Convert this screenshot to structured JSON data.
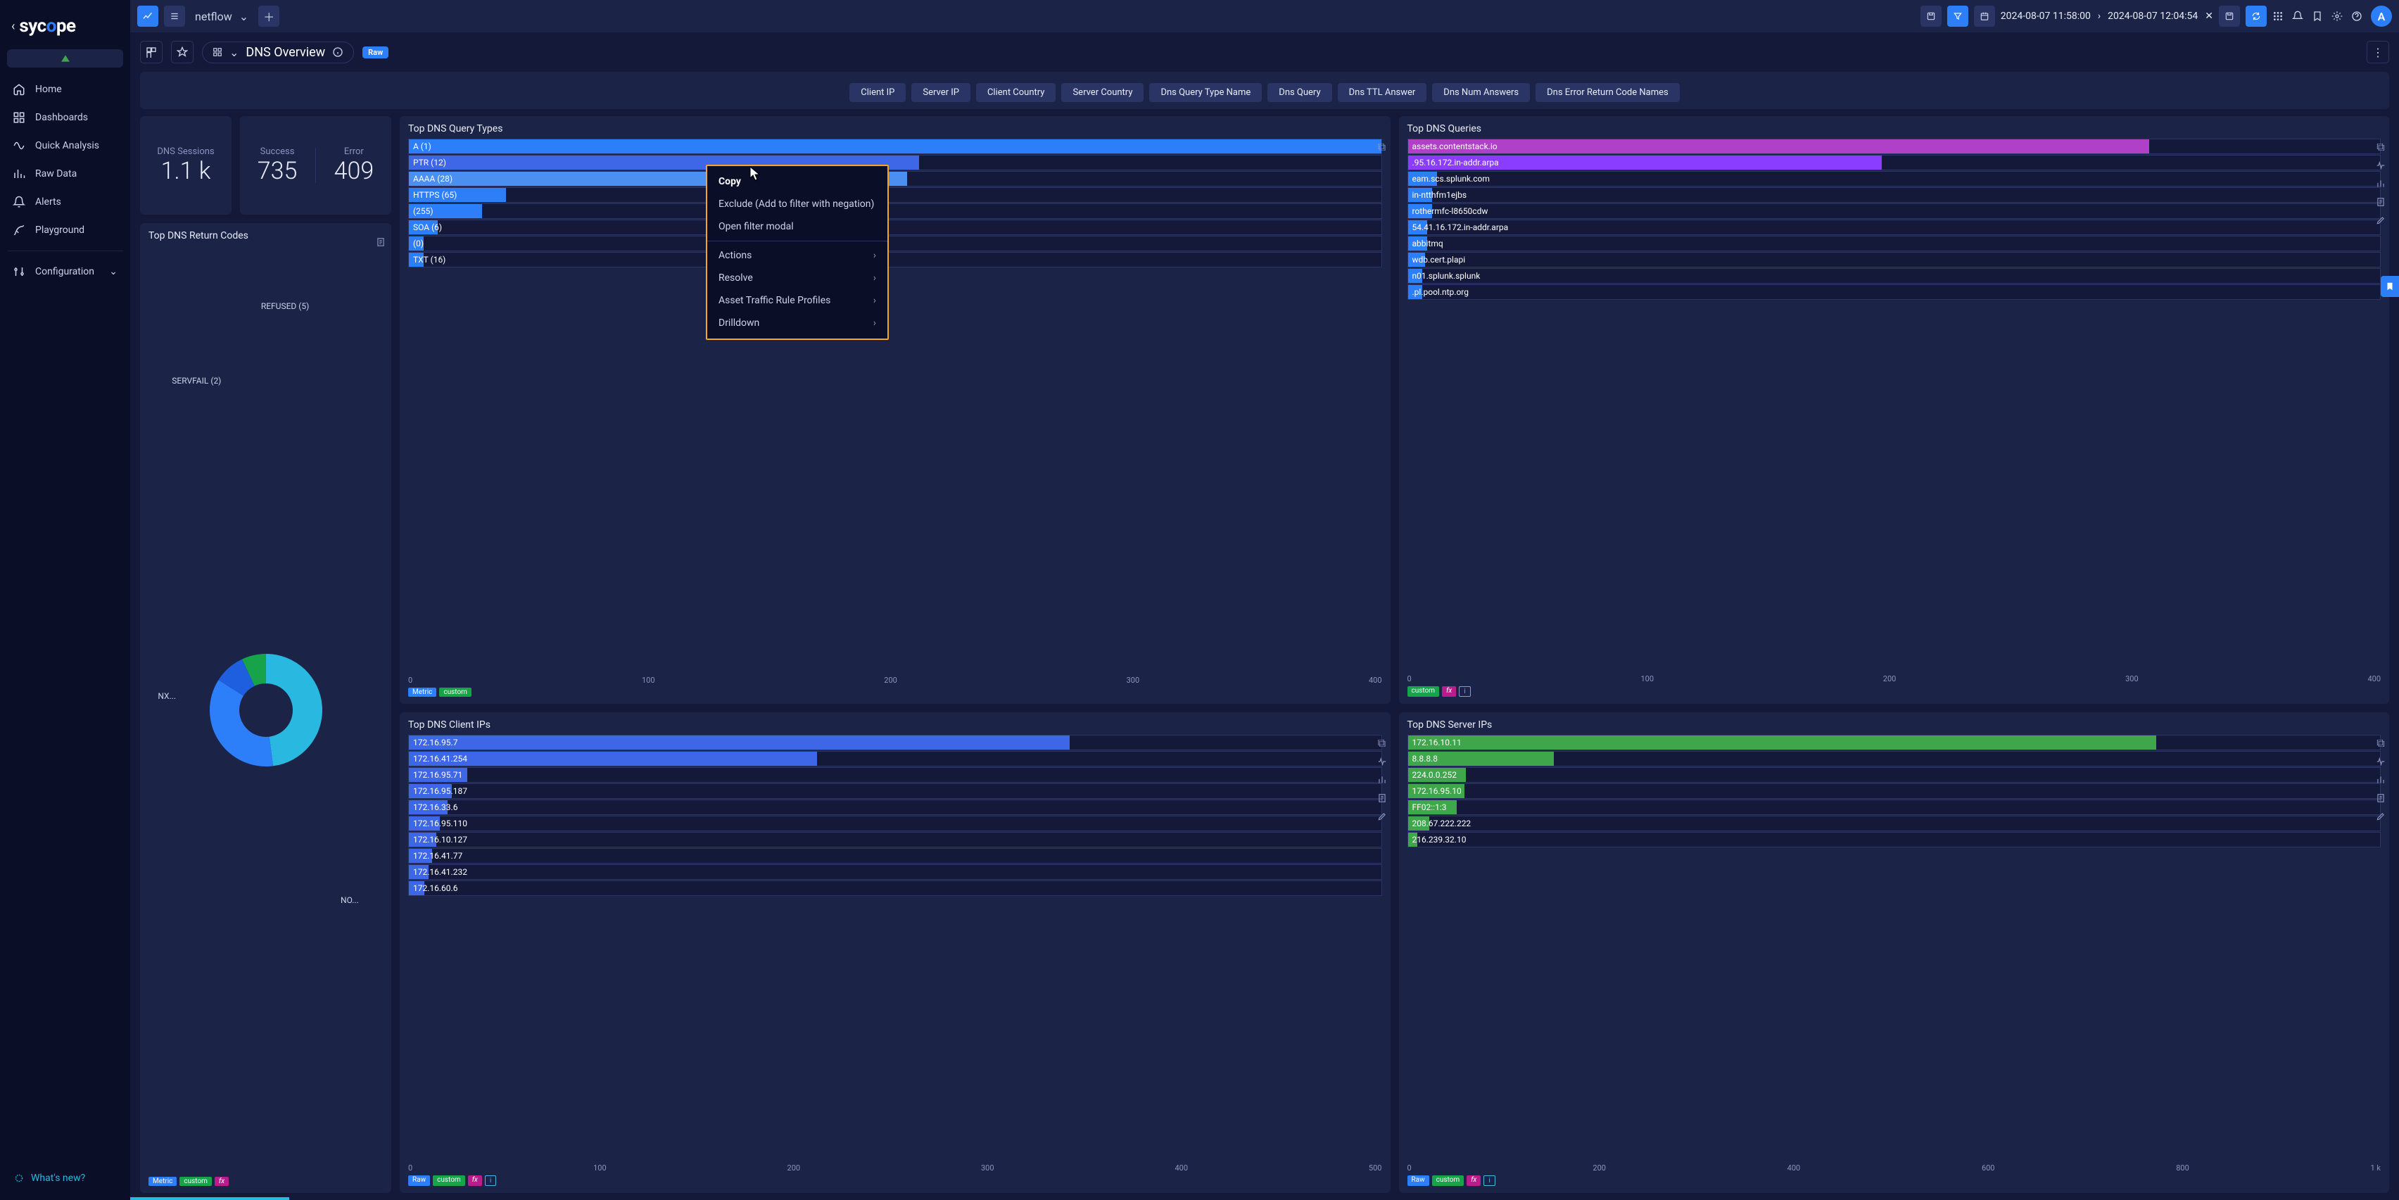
{
  "logo": {
    "text_pre": "syc",
    "text_mid": "o",
    "text_post": "pe"
  },
  "sidebar": {
    "items": [
      {
        "id": "home",
        "label": "Home"
      },
      {
        "id": "dashboards",
        "label": "Dashboards"
      },
      {
        "id": "quick-analysis",
        "label": "Quick Analysis"
      },
      {
        "id": "raw-data",
        "label": "Raw Data"
      },
      {
        "id": "alerts",
        "label": "Alerts"
      },
      {
        "id": "playground",
        "label": "Playground"
      }
    ],
    "config": {
      "label": "Configuration"
    },
    "whatsnew": "What's new?"
  },
  "topbar": {
    "stream": "netflow",
    "date_from": "2024-08-07 11:58:00",
    "date_to": "2024-08-07 12:04:54",
    "avatar_initial": "A"
  },
  "subhead": {
    "title": "DNS Overview",
    "raw_badge": "Raw"
  },
  "filters": [
    "Client IP",
    "Server IP",
    "Client Country",
    "Server Country",
    "Dns Query Type Name",
    "Dns Query",
    "Dns TTL Answer",
    "Dns Num Answers",
    "Dns Error Return Code Names"
  ],
  "kpis": {
    "sessions": {
      "label": "DNS Sessions",
      "value": "1.1 k"
    },
    "success": {
      "label": "Success",
      "value": "735"
    },
    "error": {
      "label": "Error",
      "value": "409"
    }
  },
  "cards": {
    "qtypes": {
      "title": "Top DNS Query Types"
    },
    "queries": {
      "title": "Top DNS Queries"
    },
    "retcodes": {
      "title": "Top DNS Return Codes"
    },
    "cip": {
      "title": "Top DNS Client IPs"
    },
    "sip": {
      "title": "Top DNS Server IPs"
    }
  },
  "badges": {
    "metric": "Metric",
    "custom": "custom",
    "raw": "Raw",
    "fx": "fx",
    "i": "i"
  },
  "context_menu": {
    "items": [
      {
        "label": "Copy",
        "bold": true
      },
      {
        "label": "Exclude (Add to filter with negation)"
      },
      {
        "label": "Open filter modal"
      },
      {
        "sep": true
      },
      {
        "label": "Actions",
        "sub": true
      },
      {
        "label": "Resolve",
        "sub": true
      },
      {
        "label": "Asset Traffic Rule Profiles",
        "sub": true
      },
      {
        "label": "Drilldown",
        "sub": true
      }
    ]
  },
  "chart_data": {
    "query_types": {
      "type": "bar",
      "orientation": "horizontal",
      "xlim": [
        0,
        400
      ],
      "xticks": [
        0,
        100,
        200,
        300,
        400
      ],
      "items": [
        {
          "label": "A (1)",
          "value": 400,
          "color": "#2d7ff9"
        },
        {
          "label": "PTR (12)",
          "value": 210,
          "color": "#3d67e6"
        },
        {
          "label": "AAAA (28)",
          "value": 205,
          "color": "#4b8ff0"
        },
        {
          "label": "HTTPS (65)",
          "value": 40,
          "color": "#2d7ff9"
        },
        {
          "label": " (255)",
          "value": 30,
          "color": "#2d7ff9"
        },
        {
          "label": "SOA (6)",
          "value": 12,
          "color": "#2d7ff9"
        },
        {
          "label": " (0)",
          "value": 6,
          "color": "#2d7ff9"
        },
        {
          "label": "TXT (16)",
          "value": 6,
          "color": "#2d7ff9"
        }
      ],
      "footer": [
        "metric",
        "custom"
      ]
    },
    "queries": {
      "type": "bar",
      "orientation": "horizontal",
      "xlim": [
        0,
        400
      ],
      "xticks": [
        0,
        100,
        200,
        300,
        400
      ],
      "obscured_left": true,
      "items": [
        {
          "label": "assets.contentstack.io",
          "value": 305,
          "color": "#b140c8"
        },
        {
          "label": ".95.16.172.in-addr.arpa",
          "value": 195,
          "color": "#8a3dff"
        },
        {
          "label": "eam.scs.splunk.com",
          "value": 12,
          "color": "#2d7ff9"
        },
        {
          "label": "in-ntthfm1ejbs",
          "value": 10,
          "color": "#2d7ff9"
        },
        {
          "label": "rothermfc-l8650cdw",
          "value": 10,
          "color": "#2d7ff9"
        },
        {
          "label": "54.41.16.172.in-addr.arpa",
          "value": 8,
          "color": "#2d7ff9"
        },
        {
          "label": "abbitmq",
          "value": 8,
          "color": "#2d7ff9"
        },
        {
          "label": "wdb.cert.plapi",
          "value": 7,
          "color": "#2d7ff9"
        },
        {
          "label": "n01.splunk.splunk",
          "value": 6,
          "color": "#2d7ff9"
        },
        {
          "label": ".pl.pool.ntp.org",
          "value": 6,
          "color": "#2d7ff9"
        }
      ],
      "footer": [
        "custom",
        "fx",
        "i"
      ]
    },
    "client_ips": {
      "type": "bar",
      "orientation": "horizontal",
      "xlim": [
        0,
        500
      ],
      "xticks": [
        0,
        100,
        200,
        300,
        400,
        500
      ],
      "items": [
        {
          "label": "172.16.95.7",
          "value": 340,
          "color": "#3d67e6"
        },
        {
          "label": "172.16.41.254",
          "value": 210,
          "color": "#3d67e6"
        },
        {
          "label": "172.16.95.71",
          "value": 30,
          "color": "#3d67e6"
        },
        {
          "label": "172.16.95.187",
          "value": 22,
          "color": "#3d67e6"
        },
        {
          "label": "172.16.33.6",
          "value": 20,
          "color": "#3d67e6"
        },
        {
          "label": "172.16.95.110",
          "value": 16,
          "color": "#3d67e6"
        },
        {
          "label": "172.16.10.127",
          "value": 14,
          "color": "#3d67e6"
        },
        {
          "label": "172.16.41.77",
          "value": 12,
          "color": "#3d67e6"
        },
        {
          "label": "172.16.41.232",
          "value": 10,
          "color": "#3d67e6"
        },
        {
          "label": "172.16.60.6",
          "value": 8,
          "color": "#3d67e6"
        }
      ],
      "footer": [
        "raw",
        "custom",
        "fx",
        "i"
      ],
      "footer_alt": [
        "metric",
        "custom",
        "fx"
      ]
    },
    "server_ips": {
      "type": "bar",
      "orientation": "horizontal",
      "xlim": [
        0,
        1000
      ],
      "xticks": [
        "0",
        "200",
        "400",
        "600",
        "800",
        "1 k"
      ],
      "items": [
        {
          "label": "172.16.10.11",
          "value": 770,
          "color": "#3fa64b"
        },
        {
          "label": "8.8.8.8",
          "value": 150,
          "color": "#3fa64b"
        },
        {
          "label": "224.0.0.252",
          "value": 60,
          "color": "#3fa64b"
        },
        {
          "label": "172.16.95.10",
          "value": 58,
          "color": "#3fa64b"
        },
        {
          "label": "FF02::1:3",
          "value": 50,
          "color": "#3fa64b"
        },
        {
          "label": "208.67.222.222",
          "value": 22,
          "color": "#3fa64b"
        },
        {
          "label": "216.239.32.10",
          "value": 10,
          "color": "#3fa64b"
        }
      ],
      "footer": [
        "raw",
        "custom",
        "fx",
        "i"
      ]
    },
    "return_codes": {
      "type": "pie",
      "slices": [
        {
          "label": "NO...",
          "value": 48,
          "color": "#28b8e0"
        },
        {
          "label": "NX...",
          "value": 36,
          "color": "#2d7ff9"
        },
        {
          "label": "SERVFAIL (2)",
          "value": 9,
          "color": "#1e5fe0"
        },
        {
          "label": "REFUSED (5)",
          "value": 7,
          "color": "#16a34a"
        }
      ]
    }
  },
  "progress_pct": 7
}
